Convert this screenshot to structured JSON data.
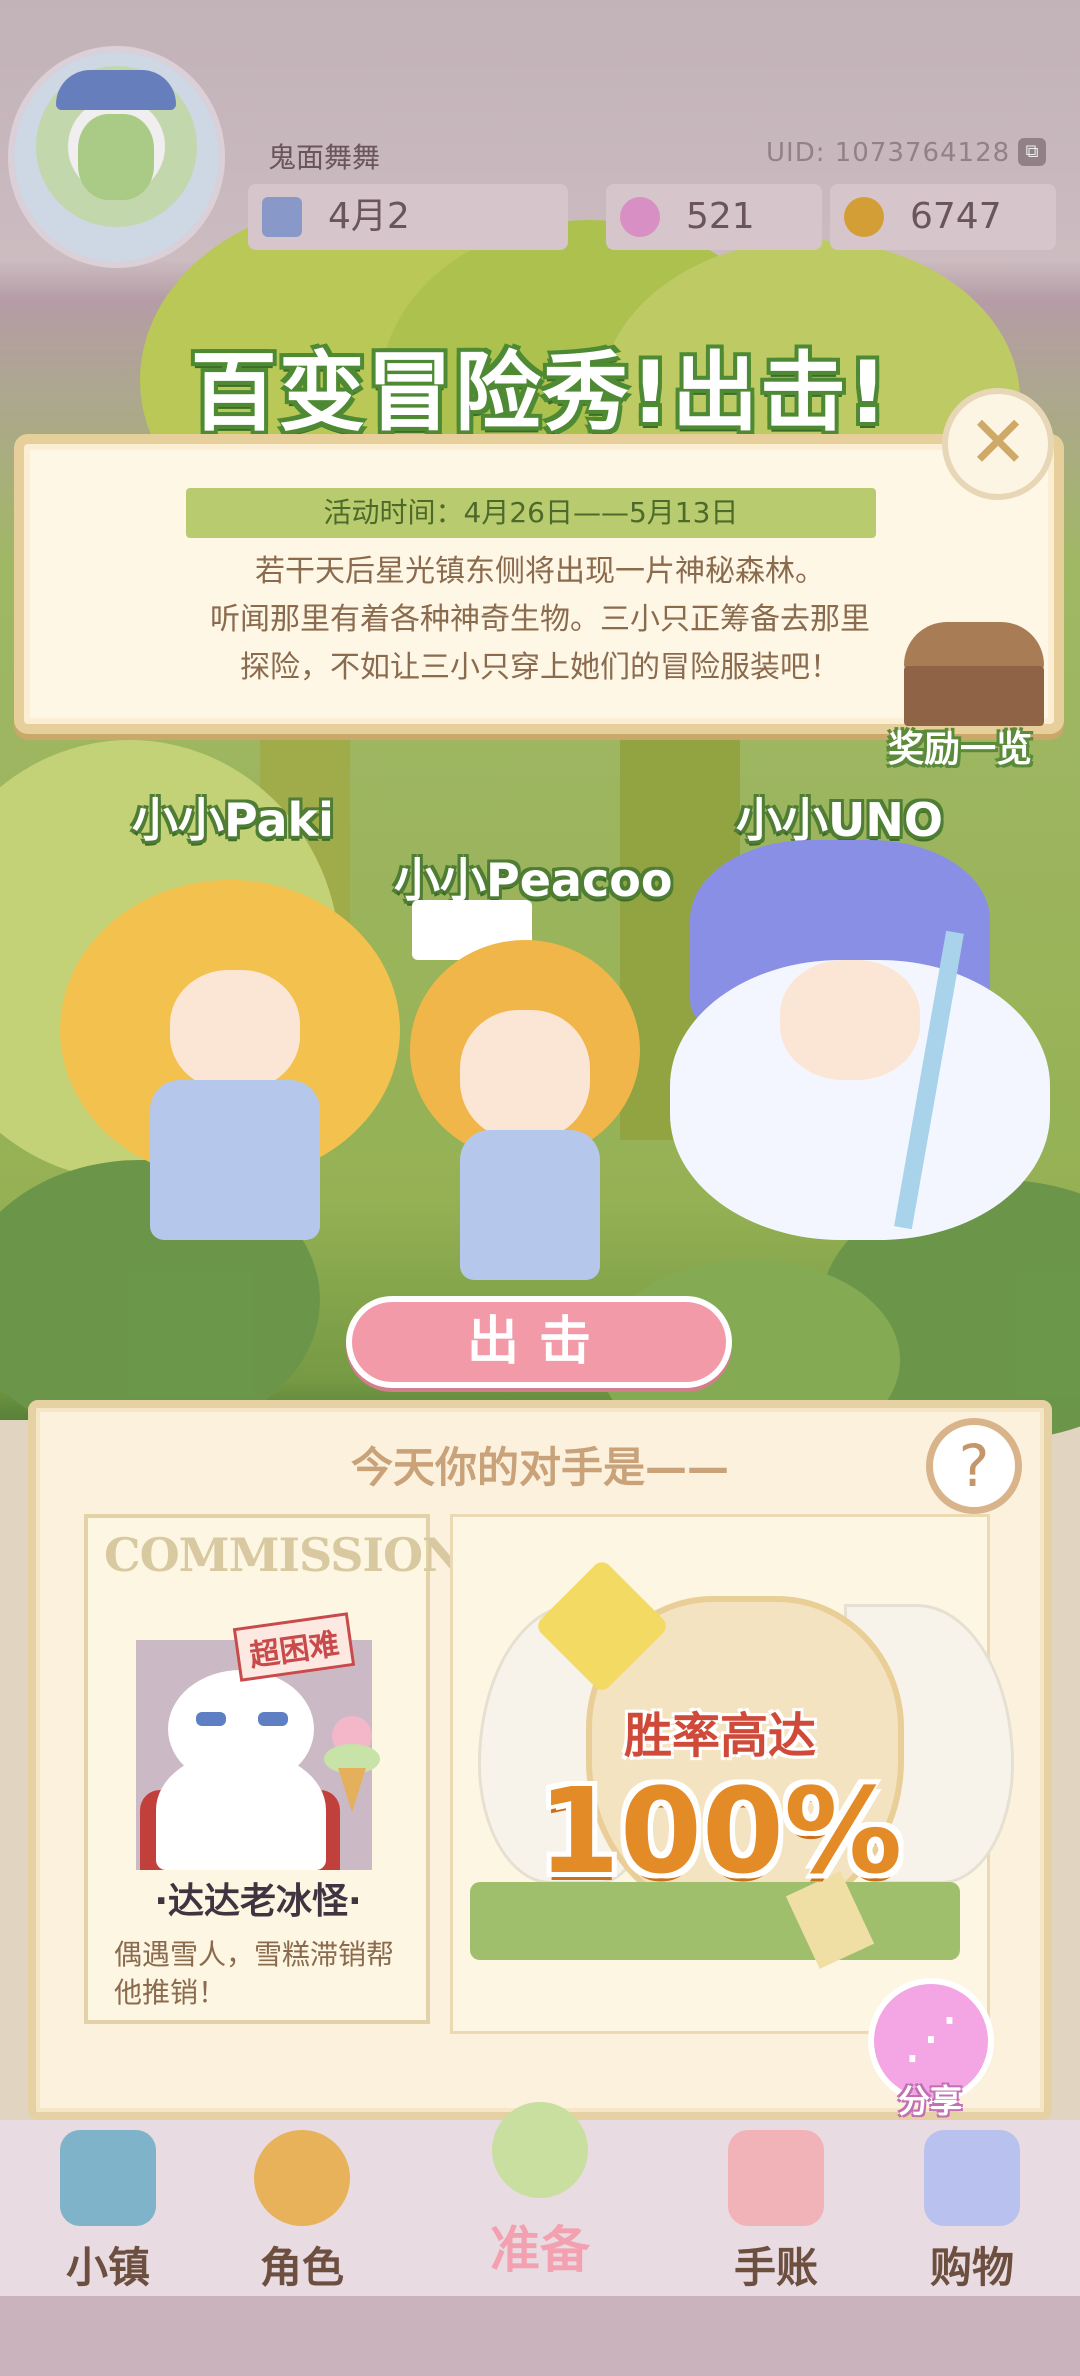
{
  "header": {
    "player_name": "鬼面舞舞",
    "uid": "UID: 1073764128",
    "date_partial": "4月2",
    "gems": "521",
    "coins": "6747"
  },
  "event": {
    "title": "百变冒险秀!出击!",
    "time": "活动时间：4月26日——5月13日",
    "description_lines": [
      "若干天后星光镇东侧将出现一片神秘森林。",
      "听闻那里有着各种神奇生物。三小只正筹备去那里",
      "探险，不如让三小只穿上她们的冒险服装吧！"
    ],
    "reward_label": "奖励一览",
    "close_icon": "✕"
  },
  "characters": [
    {
      "name": "小小Paki"
    },
    {
      "name": "小小Peacoo"
    },
    {
      "name": "小小UNO"
    }
  ],
  "go_button": "出击",
  "opponent": {
    "heading": "今天你的对手是——",
    "help_icon": "?",
    "poster_header": "COMMISSION",
    "difficulty": "超困难",
    "name": "·达达老冰怪·",
    "description": "偶遇雪人，雪糕滞销帮他推销！"
  },
  "win_rate": {
    "label": "胜率高达",
    "value": "100%"
  },
  "share": {
    "label": "分享"
  },
  "nav": [
    {
      "label": "小镇",
      "icon": "map-icon"
    },
    {
      "label": "角色",
      "icon": "character-icon"
    },
    {
      "label": "准备",
      "icon": "prepare-icon"
    },
    {
      "label": "手账",
      "icon": "journal-icon"
    },
    {
      "label": "购物",
      "icon": "shopping-bag-icon"
    }
  ],
  "colors": {
    "title_outline": "#4e8a33",
    "go_button": "#f39aa9",
    "win_value": "#e38b27",
    "accent_green": "#b8cc6f"
  }
}
